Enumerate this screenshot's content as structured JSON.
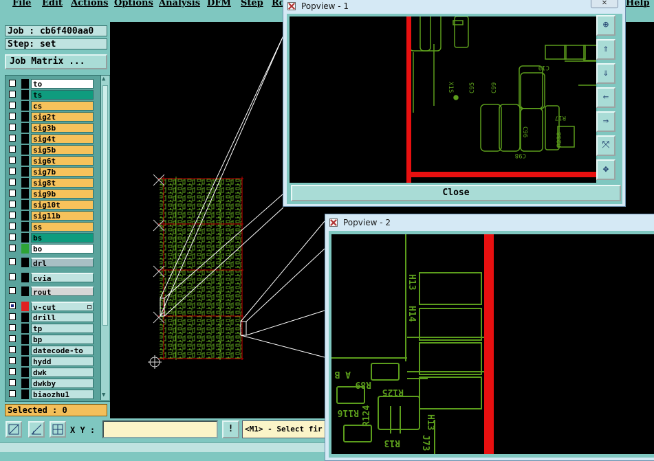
{
  "menu": [
    "File",
    "Edit",
    "Actions",
    "Options",
    "Analysis",
    "DFM",
    "Step",
    "Ro",
    "Help"
  ],
  "job": "Job : cb6f400aa0",
  "step": "Step: set",
  "job_matrix_label": "Job Matrix ...",
  "layers": [
    {
      "name": "to",
      "color": "#ffffff",
      "swatch": "#000000"
    },
    {
      "name": "ts",
      "color": "#0f9c7e",
      "swatch": "#000000"
    },
    {
      "name": "cs",
      "color": "#f7c25b",
      "swatch": "#000000"
    },
    {
      "name": "sig2t",
      "color": "#f7c25b",
      "swatch": "#000000"
    },
    {
      "name": "sig3b",
      "color": "#f7c25b",
      "swatch": "#000000"
    },
    {
      "name": "sig4t",
      "color": "#f7c25b",
      "swatch": "#000000"
    },
    {
      "name": "sig5b",
      "color": "#f7c25b",
      "swatch": "#000000"
    },
    {
      "name": "sig6t",
      "color": "#f7c25b",
      "swatch": "#000000"
    },
    {
      "name": "sig7b",
      "color": "#f7c25b",
      "swatch": "#000000"
    },
    {
      "name": "sig8t",
      "color": "#f7c25b",
      "swatch": "#000000"
    },
    {
      "name": "sig9b",
      "color": "#f7c25b",
      "swatch": "#000000"
    },
    {
      "name": "sig10t",
      "color": "#f7c25b",
      "swatch": "#000000"
    },
    {
      "name": "sig11b",
      "color": "#f7c25b",
      "swatch": "#000000"
    },
    {
      "name": "ss",
      "color": "#f7c25b",
      "swatch": "#000000"
    },
    {
      "name": "bs",
      "color": "#0f9c7e",
      "swatch": "#000000"
    },
    {
      "name": "bo",
      "color": "#ffffff",
      "swatch": "#2ea336"
    },
    {
      "name": "drl",
      "color": "#a8bfc4",
      "swatch": "#000000",
      "group": true
    },
    {
      "name": "cvia",
      "color": "#bfe3e0",
      "swatch": "#000000",
      "group": true
    },
    {
      "name": "rout",
      "color": "#d6d6d6",
      "swatch": "#000000",
      "group": true
    },
    {
      "name": "v-cut",
      "color": "#bfe3e0",
      "swatch": "#e02020",
      "group": true,
      "checked": true
    },
    {
      "name": "drill",
      "color": "#bfe3e0",
      "swatch": "#000000"
    },
    {
      "name": "tp",
      "color": "#bfe3e0",
      "swatch": "#000000"
    },
    {
      "name": "bp",
      "color": "#bfe3e0",
      "swatch": "#000000"
    },
    {
      "name": "datecode-to",
      "color": "#bfe3e0",
      "swatch": "#000000"
    },
    {
      "name": "hydd",
      "color": "#bfe3e0",
      "swatch": "#000000"
    },
    {
      "name": "dwk",
      "color": "#bfe3e0",
      "swatch": "#000000"
    },
    {
      "name": "dwkby",
      "color": "#bfe3e0",
      "swatch": "#000000"
    },
    {
      "name": "biaozhu1",
      "color": "#bfe3e0",
      "swatch": "#000000"
    }
  ],
  "selected": "Selected : 0",
  "xy_label": "X Y :",
  "xy_value": "",
  "exclaim_label": "!",
  "prompt": "<M1> - Select fir",
  "popview1": {
    "title": "Popview - 1",
    "close_label": "Close"
  },
  "popview2": {
    "title": "Popview - 2"
  },
  "colors": {
    "board": "#5c9e1c",
    "cut": "#e81010",
    "ui": "#7fc7c0"
  }
}
